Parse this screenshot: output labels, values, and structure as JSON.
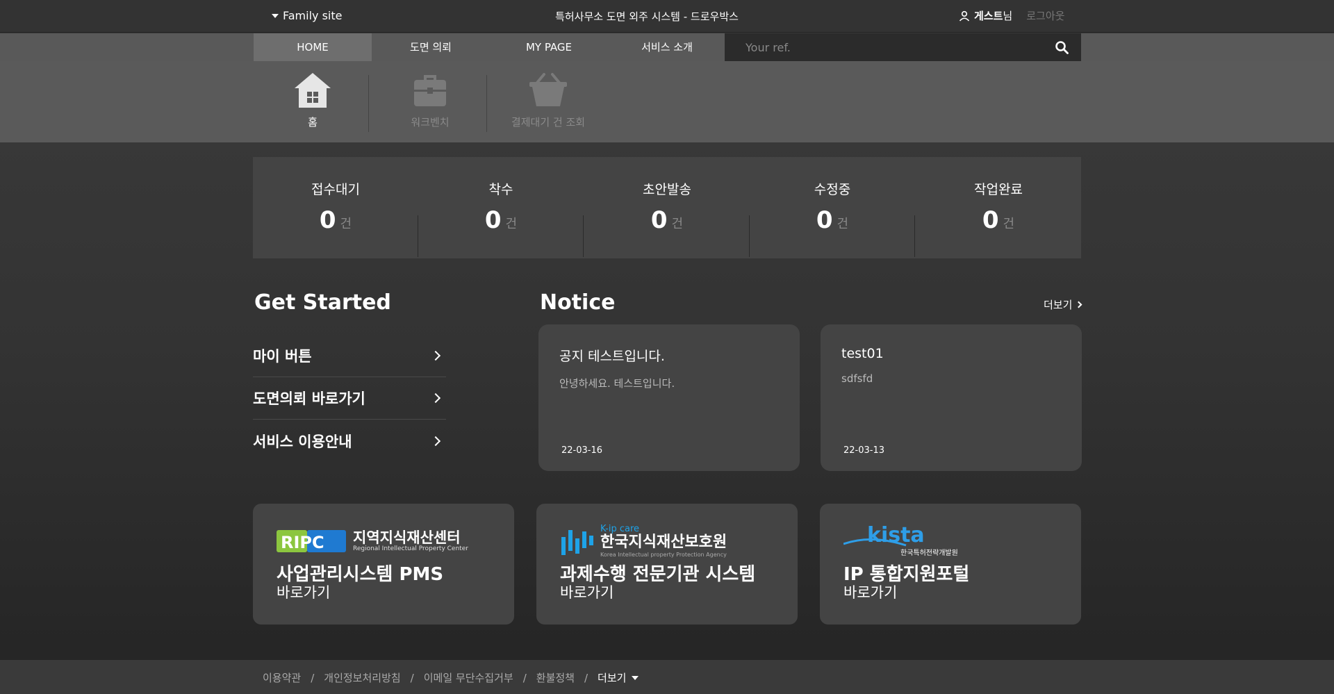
{
  "topbar": {
    "family_site": "Family site",
    "site_title": "특허사무소 도면 외주 시스템 - 드로우박스",
    "user_name": "게스트",
    "user_suffix": "님",
    "logout": "로그아웃"
  },
  "nav": {
    "items": [
      "HOME",
      "도면 의뢰",
      "MY PAGE",
      "서비스 소개"
    ],
    "active": "HOME",
    "search_placeholder": "Your ref."
  },
  "quick_icons": [
    {
      "label": "홈",
      "icon": "home-icon",
      "active": true
    },
    {
      "label": "워크벤치",
      "icon": "briefcase-icon",
      "active": false
    },
    {
      "label": "결제대기 건 조회",
      "icon": "basket-icon",
      "active": false
    }
  ],
  "stats": [
    {
      "title": "접수대기",
      "count": "0",
      "unit": "건"
    },
    {
      "title": "착수",
      "count": "0",
      "unit": "건"
    },
    {
      "title": "초안발송",
      "count": "0",
      "unit": "건"
    },
    {
      "title": "수정중",
      "count": "0",
      "unit": "건"
    },
    {
      "title": "작업완료",
      "count": "0",
      "unit": "건"
    }
  ],
  "get_started": {
    "title": "Get Started",
    "items": [
      "마이 버튼",
      "도면의뢰 바로가기",
      "서비스 이용안내"
    ]
  },
  "notice": {
    "title": "Notice",
    "more": "더보기",
    "cards": [
      {
        "title": "공지 테스트입니다.",
        "body": "안녕하세요. 테스트입니다.",
        "date": "22-03-16"
      },
      {
        "title": "test01",
        "body": "sdfsfd",
        "date": "22-03-13"
      }
    ]
  },
  "links": [
    {
      "logo_text": "지역지식재산센터",
      "logo_sub": "Regional Intellectual Property Center",
      "logo_mark": "RIPC",
      "main": "사업관리시스템 PMS",
      "go": "바로가기"
    },
    {
      "logo_text": "한국지식재산보호원",
      "logo_sub": "Korea Intellectual property Protection Agency",
      "logo_mark": "K-ip care",
      "main": "과제수행 전문기관 시스템",
      "go": "바로가기"
    },
    {
      "logo_text": "한국특허전략개발원",
      "logo_sub": "",
      "logo_mark": "kista",
      "main": "IP 통합지원포털",
      "go": "바로가기"
    }
  ],
  "footer": {
    "links": [
      "이용약관",
      "개인정보처리방침",
      "이메일 무단수집거부",
      "환불정책"
    ],
    "more": "더보기"
  },
  "colors": {
    "ripc_green": "#8cc63f",
    "ripc_blue": "#1f7ad1",
    "kipcare_blue": "#1ea3e8",
    "kista_blue": "#2e9ee8"
  }
}
